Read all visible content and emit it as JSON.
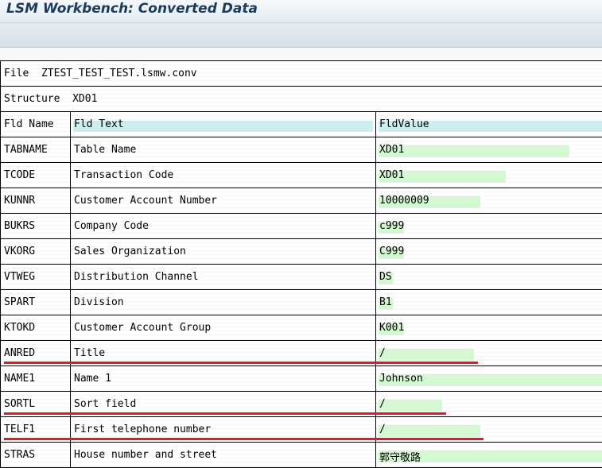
{
  "window": {
    "title": "LSM Workbench: Converted Data"
  },
  "info": {
    "file_label": "File",
    "file_value": "ZTEST_TEST_TEST.lsmw.conv",
    "structure_label": "Structure",
    "structure_value": "XD01"
  },
  "columns": {
    "name": "Fld Name",
    "text": "Fld Text",
    "value": "FldValue"
  },
  "rows": [
    {
      "name": "TABNAME",
      "text": "Table Name",
      "value": "XD01"
    },
    {
      "name": "TCODE",
      "text": "Transaction Code",
      "value": "XD01"
    },
    {
      "name": "KUNNR",
      "text": "Customer Account Number",
      "value": "10000009"
    },
    {
      "name": "BUKRS",
      "text": "Company Code",
      "value": "c999"
    },
    {
      "name": "VKORG",
      "text": "Sales Organization",
      "value": "C999"
    },
    {
      "name": "VTWEG",
      "text": "Distribution Channel",
      "value": "DS"
    },
    {
      "name": "SPART",
      "text": "Division",
      "value": "B1"
    },
    {
      "name": "KTOKD",
      "text": "Customer Account Group",
      "value": "K001"
    },
    {
      "name": "ANRED",
      "text": "Title",
      "value": "/"
    },
    {
      "name": "NAME1",
      "text": "Name 1",
      "value": "Johnson"
    },
    {
      "name": "SORTL",
      "text": "Sort field",
      "value": "/"
    },
    {
      "name": "TELF1",
      "text": "First telephone number",
      "value": "/"
    },
    {
      "name": "STRAS",
      "text": "House number and street",
      "value": "郭守敬路"
    }
  ],
  "colors": {
    "highlight_underline": "#d61d24",
    "value_field_bg": "#d5f7d1",
    "header_bg": "#cdeef0"
  }
}
